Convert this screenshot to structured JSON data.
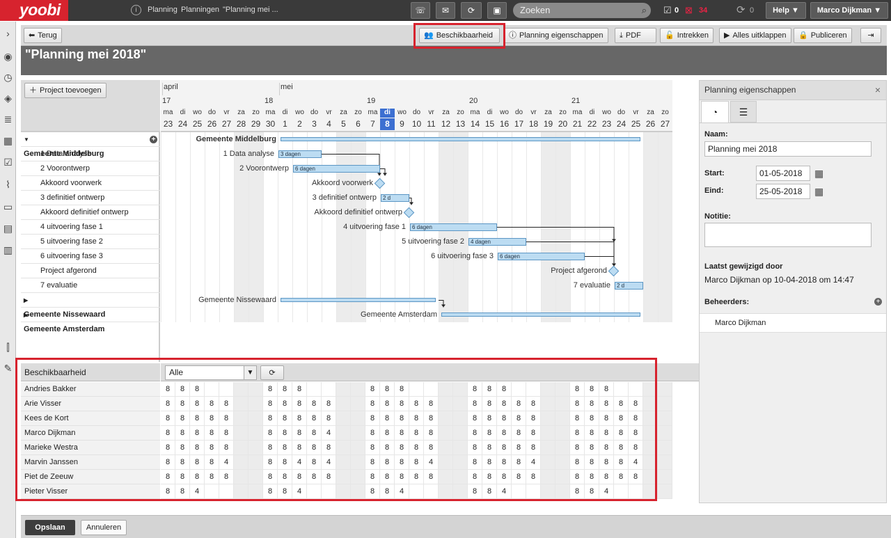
{
  "app": {
    "logo": "yoobi",
    "breadcrumbs": [
      "Planning",
      "Planningen",
      "\"Planning mei ..."
    ],
    "search_placeholder": "Zoeken",
    "task_count": "0",
    "alert_count": "34",
    "sync_count": "0",
    "help_label": "Help",
    "user_label": "Marco Dijkman"
  },
  "toolbar": {
    "back": "Terug",
    "availability": "Beschikbaarheid",
    "properties": "Planning eigenschappen",
    "pdf": "PDF",
    "retract": "Intrekken",
    "expand_all": "Alles uitklappen",
    "publish": "Publiceren"
  },
  "page": {
    "title": "\"Planning mei 2018\""
  },
  "gantt": {
    "add_project": "Project toevoegen",
    "months": [
      {
        "label": "april",
        "col": 0
      },
      {
        "label": "mei",
        "col": 8
      }
    ],
    "weeks": [
      {
        "label": "17",
        "col": 0
      },
      {
        "label": "18",
        "col": 7
      },
      {
        "label": "19",
        "col": 14
      },
      {
        "label": "20",
        "col": 21
      },
      {
        "label": "21",
        "col": 28
      }
    ],
    "days": [
      {
        "d": "ma",
        "n": "23"
      },
      {
        "d": "di",
        "n": "24"
      },
      {
        "d": "wo",
        "n": "25"
      },
      {
        "d": "do",
        "n": "26"
      },
      {
        "d": "vr",
        "n": "27"
      },
      {
        "d": "za",
        "n": "28"
      },
      {
        "d": "zo",
        "n": "29"
      },
      {
        "d": "ma",
        "n": "30"
      },
      {
        "d": "di",
        "n": "1"
      },
      {
        "d": "wo",
        "n": "2"
      },
      {
        "d": "do",
        "n": "3"
      },
      {
        "d": "vr",
        "n": "4"
      },
      {
        "d": "za",
        "n": "5"
      },
      {
        "d": "zo",
        "n": "6"
      },
      {
        "d": "ma",
        "n": "7"
      },
      {
        "d": "di",
        "n": "8"
      },
      {
        "d": "wo",
        "n": "9"
      },
      {
        "d": "do",
        "n": "10"
      },
      {
        "d": "vr",
        "n": "11"
      },
      {
        "d": "za",
        "n": "12"
      },
      {
        "d": "zo",
        "n": "13"
      },
      {
        "d": "ma",
        "n": "14"
      },
      {
        "d": "di",
        "n": "15"
      },
      {
        "d": "wo",
        "n": "16"
      },
      {
        "d": "do",
        "n": "17"
      },
      {
        "d": "vr",
        "n": "18"
      },
      {
        "d": "za",
        "n": "19"
      },
      {
        "d": "zo",
        "n": "20"
      },
      {
        "d": "ma",
        "n": "21"
      },
      {
        "d": "di",
        "n": "22"
      },
      {
        "d": "wo",
        "n": "23"
      },
      {
        "d": "do",
        "n": "24"
      },
      {
        "d": "vr",
        "n": "25"
      },
      {
        "d": "za",
        "n": "26"
      },
      {
        "d": "zo",
        "n": "27"
      }
    ],
    "today_col": 15,
    "tasks": [
      {
        "name": "Gemeente Middelburg",
        "level": 0,
        "expanded": true,
        "kind": "summary",
        "start": 8,
        "end": 33
      },
      {
        "name": "1 Data analyse",
        "level": 1,
        "kind": "task",
        "start": 8,
        "end": 11,
        "label": "3 dagen"
      },
      {
        "name": "2 Voorontwerp",
        "level": 1,
        "kind": "task",
        "start": 9,
        "end": 15,
        "label": "6 dagen"
      },
      {
        "name": "Akkoord voorwerk",
        "level": 1,
        "kind": "milestone",
        "at": 15
      },
      {
        "name": "3 definitief ontwerp",
        "level": 1,
        "kind": "task",
        "start": 15,
        "end": 17,
        "label": "2 d"
      },
      {
        "name": "Akkoord definitief ontwerp",
        "level": 1,
        "kind": "milestone",
        "at": 17
      },
      {
        "name": "4 uitvoering fase 1",
        "level": 1,
        "kind": "task",
        "start": 17,
        "end": 23,
        "label": "6 dagen"
      },
      {
        "name": "5 uitvoering fase 2",
        "level": 1,
        "kind": "task",
        "start": 21,
        "end": 25,
        "label": "4 dagen"
      },
      {
        "name": "6 uitvoering fase 3",
        "level": 1,
        "kind": "task",
        "start": 23,
        "end": 29,
        "label": "6 dagen"
      },
      {
        "name": "Project afgerond",
        "level": 1,
        "kind": "milestone",
        "at": 31
      },
      {
        "name": "7 evaluatie",
        "level": 1,
        "kind": "task",
        "start": 31,
        "end": 33,
        "label": "2 d"
      },
      {
        "name": "Gemeente Nissewaard",
        "level": 0,
        "expanded": false,
        "kind": "summary",
        "start": 8,
        "end": 19
      },
      {
        "name": "Gemeente Amsterdam",
        "level": 0,
        "expanded": false,
        "kind": "summary",
        "start": 19,
        "end": 33
      }
    ]
  },
  "availability": {
    "title": "Beschikbaarheid",
    "filter": "Alle",
    "people": [
      {
        "name": "Andries Bakker",
        "hours": [
          "8",
          "8",
          "8",
          "",
          "",
          "",
          "",
          "8",
          "8",
          "8",
          "",
          "",
          "",
          "",
          "8",
          "8",
          "8",
          "",
          "",
          "",
          "",
          "8",
          "8",
          "8",
          "",
          "",
          "",
          "",
          "8",
          "8",
          "8",
          "",
          "",
          "",
          ""
        ]
      },
      {
        "name": "Arie Visser",
        "hours": [
          "8",
          "8",
          "8",
          "8",
          "8",
          "",
          "",
          "8",
          "8",
          "8",
          "8",
          "8",
          "",
          "",
          "8",
          "8",
          "8",
          "8",
          "8",
          "",
          "",
          "8",
          "8",
          "8",
          "8",
          "8",
          "",
          "",
          "8",
          "8",
          "8",
          "8",
          "8",
          "",
          ""
        ]
      },
      {
        "name": "Kees de Kort",
        "hours": [
          "8",
          "8",
          "8",
          "8",
          "8",
          "",
          "",
          "8",
          "8",
          "8",
          "8",
          "8",
          "",
          "",
          "8",
          "8",
          "8",
          "8",
          "8",
          "",
          "",
          "8",
          "8",
          "8",
          "8",
          "8",
          "",
          "",
          "8",
          "8",
          "8",
          "8",
          "8",
          "",
          ""
        ]
      },
      {
        "name": "Marco Dijkman",
        "hours": [
          "8",
          "8",
          "8",
          "8",
          "8",
          "",
          "",
          "8",
          "8",
          "8",
          "8",
          "4",
          "",
          "",
          "8",
          "8",
          "8",
          "8",
          "8",
          "",
          "",
          "8",
          "8",
          "8",
          "8",
          "8",
          "",
          "",
          "8",
          "8",
          "8",
          "8",
          "8",
          "",
          ""
        ]
      },
      {
        "name": "Marieke Westra",
        "hours": [
          "8",
          "8",
          "8",
          "8",
          "8",
          "",
          "",
          "8",
          "8",
          "8",
          "8",
          "8",
          "",
          "",
          "8",
          "8",
          "8",
          "8",
          "8",
          "",
          "",
          "8",
          "8",
          "8",
          "8",
          "8",
          "",
          "",
          "8",
          "8",
          "8",
          "8",
          "8",
          "",
          ""
        ]
      },
      {
        "name": "Marvin Janssen",
        "hours": [
          "8",
          "8",
          "8",
          "8",
          "4",
          "",
          "",
          "8",
          "8",
          "4",
          "8",
          "4",
          "",
          "",
          "8",
          "8",
          "8",
          "8",
          "4",
          "",
          "",
          "8",
          "8",
          "8",
          "8",
          "4",
          "",
          "",
          "8",
          "8",
          "8",
          "8",
          "4",
          "",
          ""
        ]
      },
      {
        "name": "Piet de Zeeuw",
        "hours": [
          "8",
          "8",
          "8",
          "8",
          "8",
          "",
          "",
          "8",
          "8",
          "8",
          "8",
          "8",
          "",
          "",
          "8",
          "8",
          "8",
          "8",
          "8",
          "",
          "",
          "8",
          "8",
          "8",
          "8",
          "8",
          "",
          "",
          "8",
          "8",
          "8",
          "8",
          "8",
          "",
          ""
        ]
      },
      {
        "name": "Pieter Visser",
        "hours": [
          "8",
          "8",
          "4",
          "",
          "",
          "",
          "",
          "8",
          "8",
          "4",
          "",
          "",
          "",
          "",
          "8",
          "8",
          "4",
          "",
          "",
          "",
          "",
          "8",
          "8",
          "4",
          "",
          "",
          "",
          "",
          "8",
          "8",
          "4",
          "",
          "",
          "",
          ""
        ]
      }
    ]
  },
  "properties": {
    "title": "Planning eigenschappen",
    "name_label": "Naam:",
    "name_value": "Planning mei 2018",
    "start_label": "Start:",
    "start_value": "01-05-2018",
    "end_label": "Eind:",
    "end_value": "25-05-2018",
    "note_label": "Notitie:",
    "note_value": "",
    "modified_label": "Laatst gewijzigd door",
    "modified_value": "Marco Dijkman op 10-04-2018 om 14:47",
    "managers_label": "Beheerders:",
    "managers": [
      "Marco Dijkman"
    ]
  },
  "footer": {
    "save": "Opslaan",
    "cancel": "Annuleren"
  },
  "colors": {
    "brand": "#d7232e",
    "highlight": "#d7232e",
    "today": "#3c6fd1",
    "bar_fill": "#bcdcf2",
    "bar_border": "#5b96c4"
  }
}
